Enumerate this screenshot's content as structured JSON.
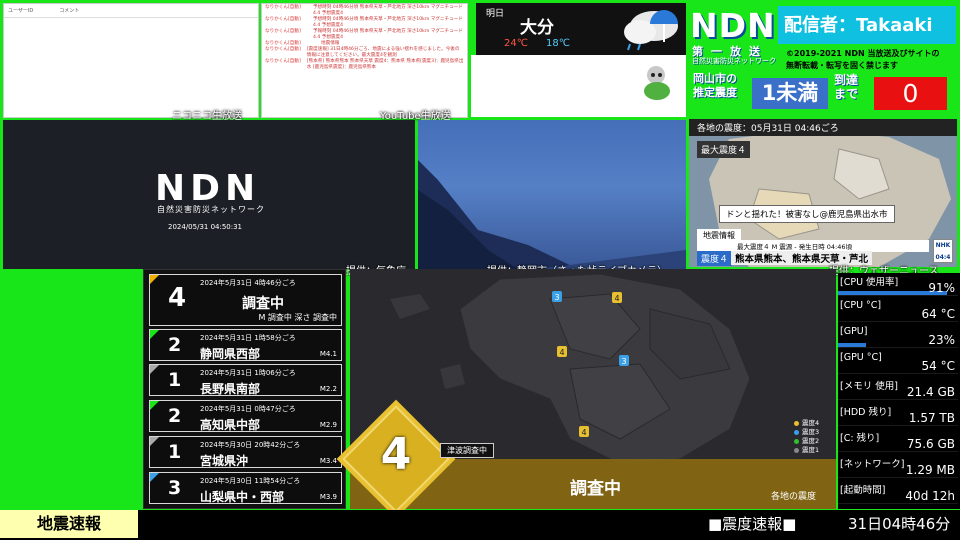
{
  "niconico": {
    "header_user": "ユーザーID",
    "header_comment": "コメント",
    "watermark": "ニコニコ生放送"
  },
  "youtube": {
    "watermark": "YouTube生放送",
    "messages": [
      {
        "name": "なりかくん[自動]",
        "text": "予想時刻 04時46分頃 熊本県天草・芦北地方 深さ10km マグニチュード4.4 予想震度4"
      },
      {
        "name": "なりかくん[自動]",
        "text": "予想時刻 04時46分頃 熊本県天草・芦北地方 深さ10km マグニチュード4.4 予想震度4"
      },
      {
        "name": "なりかくん[自動]",
        "text": "予報時刻 04時46分頃 熊本県天草・芦北地方 深さ10km マグ二チュード4.4 予想震度4"
      },
      {
        "name": "なりかくん[自動]",
        "text": "地震情報"
      },
      {
        "name": "なりかくん[自動]",
        "text": "[震度速報] 31日4時46分ごろ、地震による強い揺れを感じました。今後の情報に注意してください。最大震度4を観測"
      },
      {
        "name": "なりかくん[自動]",
        "text": "[熊本県] 熊本県熊本 熊本県天草 震度4：熊本県 熊本県[震度3]：鹿児島県出水 [鹿児島県震度]：鹿児島県熊本"
      }
    ]
  },
  "weather": {
    "day_label": "明日",
    "city": "大分",
    "high": "24℃",
    "low": "18℃"
  },
  "ndn": {
    "logo": "NDN",
    "caster": "配信者：Takaaki",
    "daiichi": "第一放送",
    "daiichi_sub": "自然災害防災ネットワーク",
    "copyright_line1": "©2019-2021 NDN 当放送及びサイトの",
    "copyright_line2": "無断転載・転写を固く禁じます",
    "est_label_line1": "岡山市の",
    "est_label_line2": "推定震度",
    "est_value": "1未満",
    "arrival_label_line1": "到達",
    "arrival_label_line2": "まで",
    "arrival_value": "0"
  },
  "ndn_video": {
    "logo": "NDN",
    "subtitle": "自然災害防災ネットワーク",
    "timestamp": "2024/05/31 04:50:31"
  },
  "nhk": {
    "header": "各地の震度：05月31日 04:46ごろ",
    "max_label": "最大震度４",
    "caption": "ドンと揺れた！被害なし@鹿児島県出水市",
    "info_label": "地震情報",
    "info_line": "最大震度４ M 震源 - 発生日時 04:46頃",
    "bottom_label": "震度４",
    "bottom_text": "熊本県熊本、熊本県天草・芦北",
    "logo": "NHK",
    "clock": "04:4"
  },
  "credits": {
    "jma": "提供：気象庁",
    "shizuoka": "提供：静岡市（さった峠ライブカメラ）",
    "weathernews": "提供：ウェザーニュース"
  },
  "earthquakes": [
    {
      "intensity": "4",
      "datetime": "2024年5月31日 4時46分ごろ",
      "place": "調査中",
      "magnitude": "M 調査中  深さ 調査中",
      "color": "#f0b000"
    },
    {
      "intensity": "2",
      "datetime": "2024年5月31日 1時58分ごろ",
      "place": "静岡県西部",
      "magnitude": "M4.1",
      "color": "#19e619"
    },
    {
      "intensity": "1",
      "datetime": "2024年5月31日 1時06分ごろ",
      "place": "長野県南部",
      "magnitude": "M2.2",
      "color": "#aaaaaa"
    },
    {
      "intensity": "2",
      "datetime": "2024年5月31日 0時47分ごろ",
      "place": "高知県中部",
      "magnitude": "M2.9",
      "color": "#19e619"
    },
    {
      "intensity": "1",
      "datetime": "2024年5月30日 20時42分ごろ",
      "place": "宮城県沖",
      "magnitude": "M3.4",
      "color": "#aaaaaa"
    },
    {
      "intensity": "3",
      "datetime": "2024年5月30日 11時54分ごろ",
      "place": "山梨県中・西部",
      "magnitude": "M3.9",
      "color": "#3aa0e8"
    }
  ],
  "map": {
    "intensity": "4",
    "tsunami": "津波調査中",
    "status": "調査中",
    "title": "各地の震度",
    "legend": [
      {
        "label": "震度4",
        "color": "#e8c030"
      },
      {
        "label": "震度3",
        "color": "#3aa0e8"
      },
      {
        "label": "震度2",
        "color": "#30c030"
      },
      {
        "label": "震度1",
        "color": "#888888"
      }
    ]
  },
  "system": [
    {
      "label": "[CPU 使用率]",
      "value": "91%",
      "usage": 0.91
    },
    {
      "label": "[CPU °C]",
      "value": "64 °C"
    },
    {
      "label": "[GPU]",
      "value": "23%",
      "usage": 0.23
    },
    {
      "label": "[GPU °C]",
      "value": "54 °C"
    },
    {
      "label": "[メモリ 使用]",
      "value": "21.4 GB"
    },
    {
      "label": "[HDD 残り]",
      "value": "1.57 TB"
    },
    {
      "label": "[C: 残り]",
      "value": "75.6 GB"
    },
    {
      "label": "[ネットワーク]",
      "value": "1.29 MB"
    },
    {
      "label": "[起動時間]",
      "value": "40d 12h"
    }
  ],
  "ticker": {
    "label": "地震速報",
    "text": "■震度速報■",
    "time": "31日04時46分"
  }
}
